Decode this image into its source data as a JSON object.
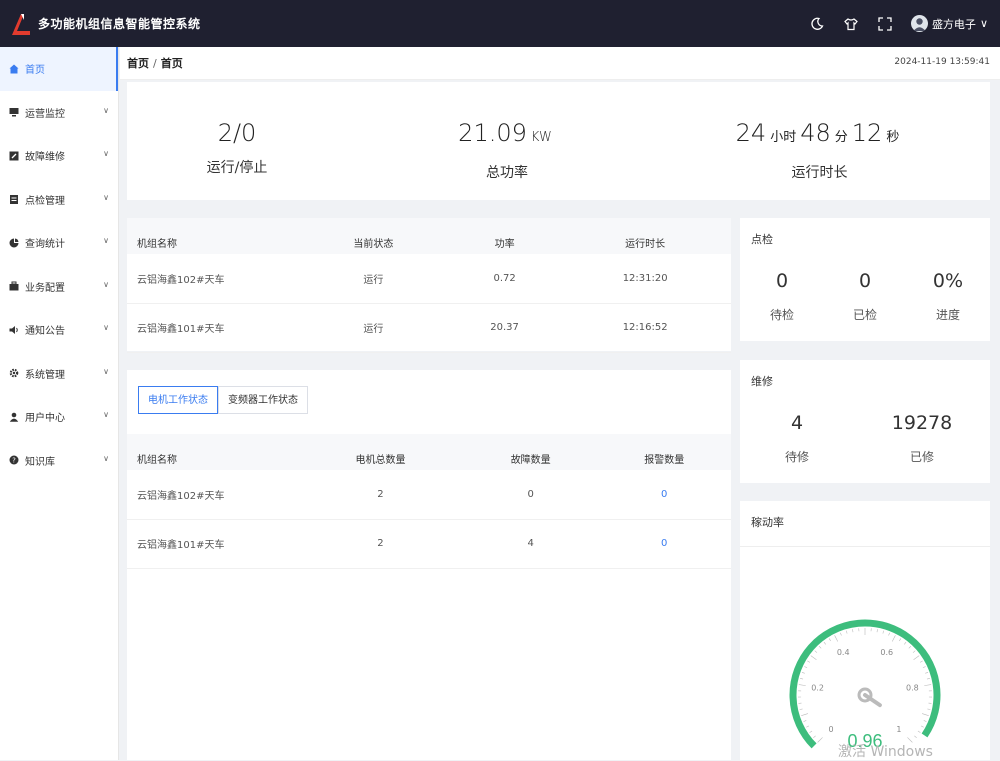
{
  "app": {
    "title": "多功能机组信息智能管控系统",
    "user": "盛方电子"
  },
  "sidebar": {
    "items": [
      {
        "label": "首页",
        "icon": "home-icon",
        "active": true
      },
      {
        "label": "运营监控",
        "icon": "monitor-icon"
      },
      {
        "label": "故障维修",
        "icon": "repair-icon"
      },
      {
        "label": "点检管理",
        "icon": "clipboard-icon"
      },
      {
        "label": "查询统计",
        "icon": "pie-icon"
      },
      {
        "label": "业务配置",
        "icon": "briefcase-icon"
      },
      {
        "label": "通知公告",
        "icon": "speaker-icon"
      },
      {
        "label": "系统管理",
        "icon": "gear-icon"
      },
      {
        "label": "用户中心",
        "icon": "user-icon"
      },
      {
        "label": "知识库",
        "icon": "help-icon"
      }
    ]
  },
  "header": {
    "breadcrumb": [
      "首页",
      "首页"
    ],
    "datetime": "2024-11-19 13:59:41"
  },
  "summary": {
    "run_stop": {
      "value": "2/0",
      "label": "运行/停止"
    },
    "power": {
      "value": "21.09",
      "unit": "KW",
      "label": "总功率"
    },
    "runtime": {
      "hours": "24",
      "hours_unit": "小时",
      "minutes": "48",
      "minutes_unit": "分",
      "seconds": "12",
      "seconds_unit": "秒",
      "label": "运行时长"
    }
  },
  "unit_table": {
    "headers": [
      "机组名称",
      "当前状态",
      "功率",
      "运行时长"
    ],
    "rows": [
      [
        "云铝海鑫102#天车",
        "运行",
        "0.72",
        "12:31:20"
      ],
      [
        "云铝海鑫101#天车",
        "运行",
        "20.37",
        "12:16:52"
      ]
    ]
  },
  "status_tabs": [
    "电机工作状态",
    "变频器工作状态"
  ],
  "motor_table": {
    "headers": [
      "机组名称",
      "电机总数量",
      "故障数量",
      "报警数量"
    ],
    "rows": [
      [
        "云铝海鑫102#天车",
        "2",
        "0",
        "0"
      ],
      [
        "云铝海鑫101#天车",
        "2",
        "4",
        "0"
      ]
    ]
  },
  "inspection": {
    "title": "点检",
    "items": [
      {
        "value": "0",
        "label": "待检"
      },
      {
        "value": "0",
        "label": "已检"
      },
      {
        "value": "0%",
        "label": "进度"
      }
    ]
  },
  "repair": {
    "title": "维修",
    "items": [
      {
        "value": "4",
        "label": "待修"
      },
      {
        "value": "19278",
        "label": "已修"
      }
    ]
  },
  "utilization": {
    "title": "稼动率",
    "value": 0.96,
    "value_text": "0.96",
    "ticks": [
      "0",
      "0.2",
      "0.4",
      "0.6",
      "0.8",
      "1"
    ],
    "color": "#3dbd7d",
    "watermark": "激活 Windows"
  }
}
